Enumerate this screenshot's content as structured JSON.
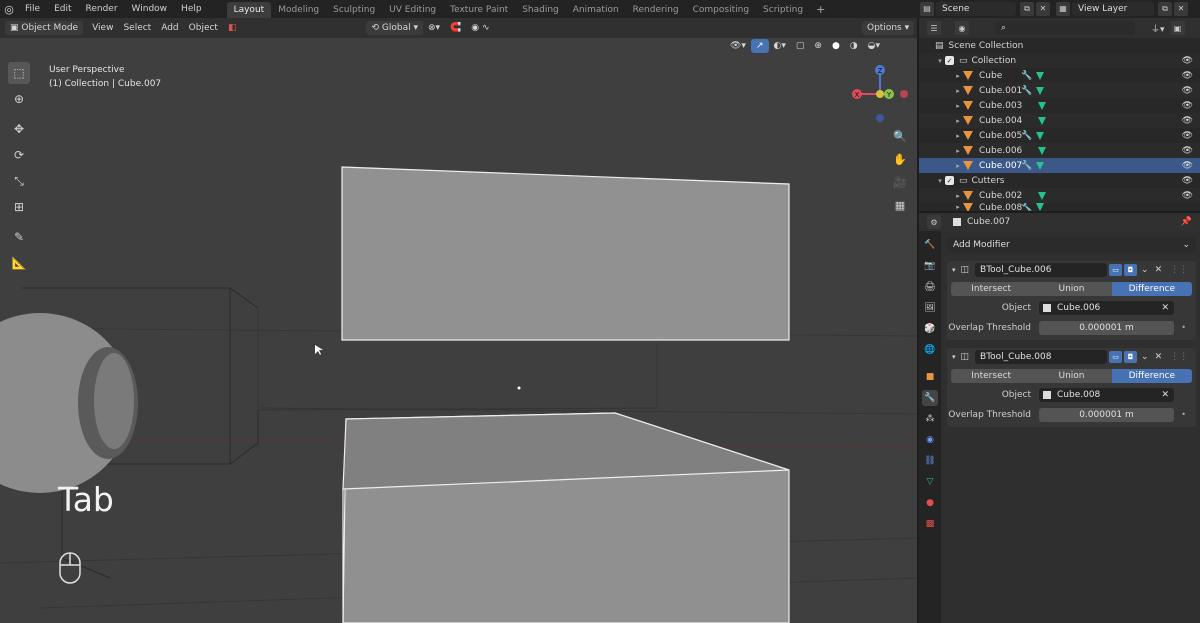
{
  "menu": [
    "File",
    "Edit",
    "Render",
    "Window",
    "Help"
  ],
  "workspaces": [
    {
      "label": "Layout",
      "active": true
    },
    {
      "label": "Modeling"
    },
    {
      "label": "Sculpting"
    },
    {
      "label": "UV Editing"
    },
    {
      "label": "Texture Paint"
    },
    {
      "label": "Shading"
    },
    {
      "label": "Animation"
    },
    {
      "label": "Rendering"
    },
    {
      "label": "Compositing"
    },
    {
      "label": "Scripting"
    }
  ],
  "scene": "Scene",
  "view_layer": "View Layer",
  "viewport": {
    "mode": "Object Mode",
    "menus": [
      "View",
      "Select",
      "Add",
      "Object"
    ],
    "transform": "Global",
    "options": "Options",
    "info_line1": "User Perspective",
    "info_line2": "(1) Collection | Cube.007",
    "key_hint": "Tab"
  },
  "gizmo": {
    "x": "X",
    "y": "Y",
    "z": "Z"
  },
  "outliner": {
    "root": "Scene Collection",
    "rows": [
      {
        "label": "Collection",
        "type": "collection"
      },
      {
        "label": "Cube",
        "type": "mesh",
        "modifier": true
      },
      {
        "label": "Cube.001",
        "type": "mesh",
        "modifier": true
      },
      {
        "label": "Cube.003",
        "type": "mesh",
        "modifier": false
      },
      {
        "label": "Cube.004",
        "type": "mesh",
        "modifier": false
      },
      {
        "label": "Cube.005",
        "type": "mesh",
        "modifier": true
      },
      {
        "label": "Cube.006",
        "type": "mesh",
        "modifier": false
      },
      {
        "label": "Cube.007",
        "type": "mesh",
        "modifier": true,
        "selected": true
      },
      {
        "label": "Cutters",
        "type": "collection"
      },
      {
        "label": "Cube.002",
        "type": "mesh",
        "modifier": false
      },
      {
        "label": "Cube.008",
        "type": "mesh",
        "modifier": false
      }
    ]
  },
  "properties": {
    "object_name": "Cube.007",
    "add_modifier": "Add Modifier",
    "modifiers": [
      {
        "name": "BTool_Cube.006",
        "ops": [
          "Intersect",
          "Union",
          "Difference"
        ],
        "active_op": "Difference",
        "object_label": "Object",
        "object": "Cube.006",
        "threshold_label": "Overlap Threshold",
        "threshold": "0.000001 m"
      },
      {
        "name": "BTool_Cube.008",
        "ops": [
          "Intersect",
          "Union",
          "Difference"
        ],
        "active_op": "Difference",
        "object_label": "Object",
        "object": "Cube.008",
        "threshold_label": "Overlap Threshold",
        "threshold": "0.000001 m"
      }
    ]
  },
  "colors": {
    "accent": "#4772b3",
    "selected_row": "#3b5889",
    "mesh_icon": "#e69440",
    "data_icon": "#25c28e"
  }
}
